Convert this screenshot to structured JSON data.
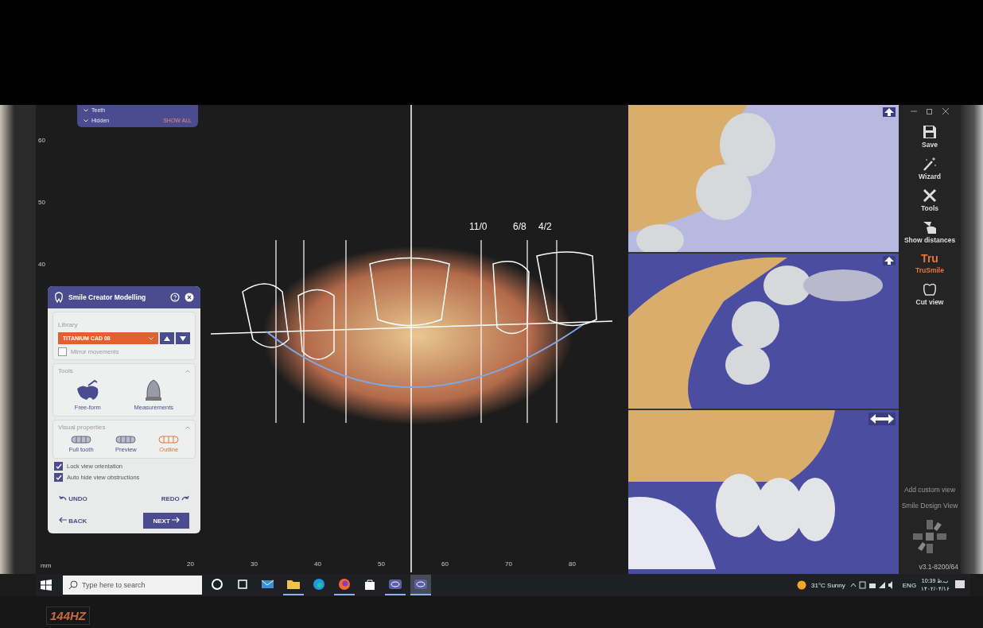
{
  "layers_panel": {
    "items": [
      {
        "label": "Teeth"
      },
      {
        "label": "Hidden",
        "action": "SHOW ALL"
      }
    ]
  },
  "ruler": {
    "y_labels": [
      "60",
      "50",
      "40"
    ],
    "x_labels": [
      "20",
      "30",
      "40",
      "50",
      "60",
      "70",
      "80"
    ],
    "unit": "mm"
  },
  "measurements": [
    "11/0",
    "6/8",
    "4/2"
  ],
  "panel": {
    "title": "Smile Creator Modelling",
    "library_label": "Library",
    "library_value": "TITANIUM CAD 08",
    "mirror": {
      "label": "Mirror movements",
      "checked": false
    },
    "tools_title": "Tools",
    "tools": [
      {
        "label": "Free-form",
        "kind": "freeform"
      },
      {
        "label": "Measurements",
        "kind": "measure"
      }
    ],
    "visual_title": "Visual properties",
    "visual": [
      {
        "label": "Full tooth",
        "selected": false
      },
      {
        "label": "Preview",
        "selected": false
      },
      {
        "label": "Outline",
        "selected": true
      }
    ],
    "checks": [
      {
        "label": "Lock view orientation",
        "checked": true
      },
      {
        "label": "Auto hide view obstructions",
        "checked": true
      }
    ],
    "undo": "UNDO",
    "redo": "REDO",
    "back": "BACK",
    "next": "NEXT"
  },
  "sidebar": {
    "items": [
      {
        "label": "Save",
        "kind": "save",
        "selected": false
      },
      {
        "label": "Wizard",
        "kind": "wizard",
        "selected": false
      },
      {
        "label": "Tools",
        "kind": "tools",
        "selected": false
      },
      {
        "label": "Show distances",
        "kind": "distances",
        "selected": false
      },
      {
        "label": "TruSmile",
        "kind": "trusmile",
        "logo": "Tru",
        "selected": true
      },
      {
        "label": "Cut view",
        "kind": "cut",
        "selected": false
      }
    ],
    "views": [
      "Add custom view",
      "Smile Design View"
    ],
    "version": "v3.1-8200/64"
  },
  "taskbar": {
    "search_placeholder": "Type here to search",
    "apps": [
      {
        "kind": "cortana",
        "running": false,
        "selected": false
      },
      {
        "kind": "taskview",
        "running": false,
        "selected": false
      },
      {
        "kind": "mail",
        "running": false,
        "selected": false
      },
      {
        "kind": "folder",
        "running": true,
        "selected": false
      },
      {
        "kind": "edge",
        "running": false,
        "selected": false
      },
      {
        "kind": "firefox",
        "running": true,
        "selected": false
      },
      {
        "kind": "store",
        "running": false,
        "selected": false
      },
      {
        "kind": "exocad",
        "running": true,
        "selected": false
      },
      {
        "kind": "exocad",
        "running": true,
        "selected": true
      }
    ],
    "weather": "31°C Sunny",
    "language": "ENG",
    "time": "10:39 ب.ظ",
    "date": "۱۴۰۲/۰۴/۱۶"
  },
  "bezel_label": "144HZ"
}
